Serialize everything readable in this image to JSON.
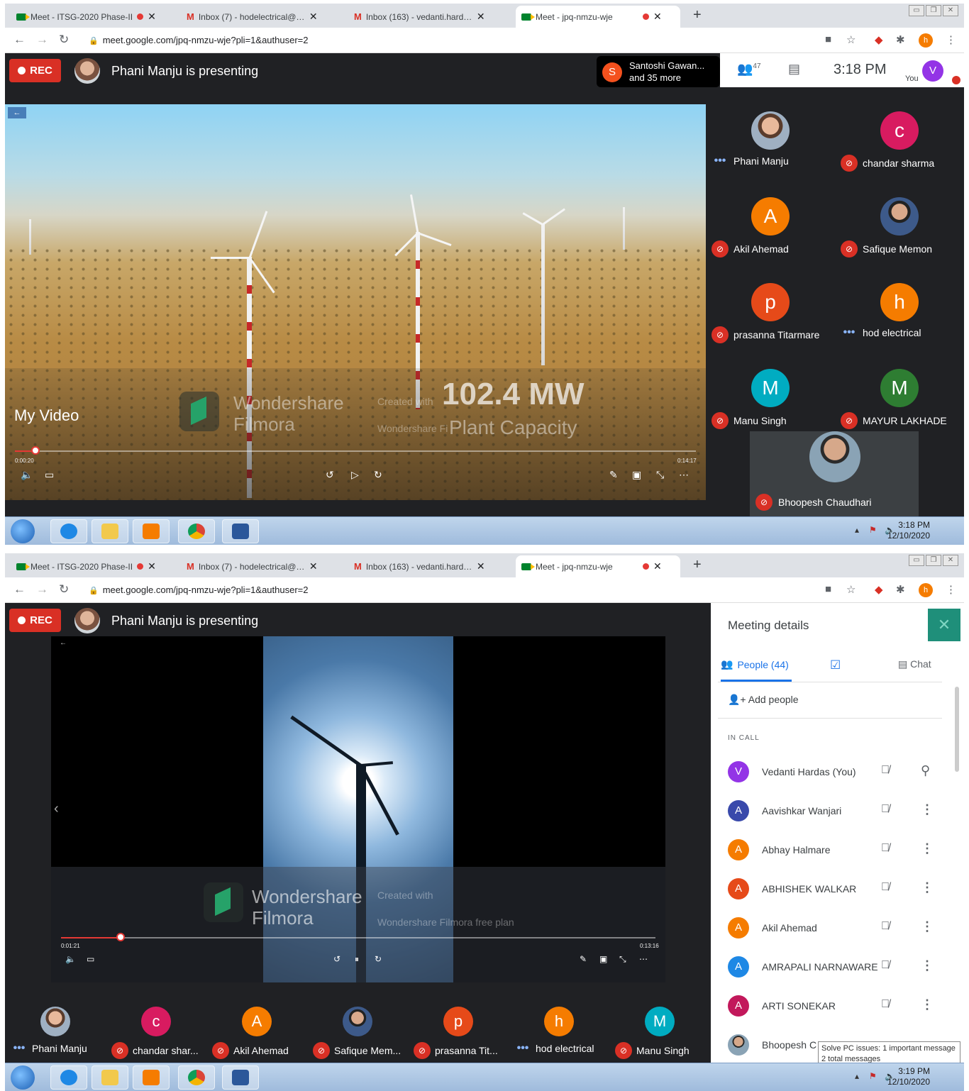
{
  "tabs": [
    {
      "title": "Meet - ITSG-2020 Phase-II",
      "icon": "meet-icon",
      "recording": true
    },
    {
      "title": "Inbox (7) - hodelectrical@kdkce.",
      "icon": "gmail-icon"
    },
    {
      "title": "Inbox (163) - vedanti.hardas@kd",
      "icon": "gmail-icon"
    },
    {
      "title": "Meet - jpq-nmzu-wje",
      "icon": "meet-icon",
      "recording": true,
      "active": true
    }
  ],
  "url": "meet.google.com/jpq-nmzu-wje?pli=1&authuser=2",
  "profile_initial": "h",
  "rec_label": "REC",
  "presenting_text": "Phani Manju is presenting",
  "shot1": {
    "joined": {
      "initial": "S",
      "line1": "Santoshi Gawan...",
      "line2": "and 35 more"
    },
    "people_count": "47",
    "clock": "3:18 PM",
    "you_label": "You",
    "you_initial": "V",
    "video": {
      "title": "My Video",
      "watermark1": "Wondershare",
      "watermark2": "Filmora",
      "created_with": "Created with",
      "wm_plan": "Wondershare Filmora free plan",
      "overlay_big": "102.4 MW",
      "overlay_sub": "Plant Capacity",
      "time_elapsed": "0:00:20",
      "time_total": "0:14:17",
      "progress": 0.03
    },
    "tiles": [
      {
        "name": "Phani Manju",
        "status": "speaking",
        "initial": "",
        "color": "#000000",
        "photo": true
      },
      {
        "name": "chandar sharma",
        "status": "muted",
        "initial": "c",
        "color": "#d81b60"
      },
      {
        "name": "Akil Ahemad",
        "status": "muted",
        "initial": "A",
        "color": "#f57c00"
      },
      {
        "name": "Safique Memon",
        "status": "muted",
        "initial": "",
        "color": "#000000",
        "photo": true
      },
      {
        "name": "prasanna Titarmare",
        "status": "muted",
        "initial": "p",
        "color": "#e64a19"
      },
      {
        "name": "hod electrical",
        "status": "speaking",
        "initial": "h",
        "color": "#f57c00"
      },
      {
        "name": "Manu Singh",
        "status": "muted",
        "initial": "M",
        "color": "#00acc1"
      },
      {
        "name": "MAYUR LAKHADE",
        "status": "muted",
        "initial": "M",
        "color": "#2e7d32"
      }
    ],
    "featured": {
      "name": "Bhoopesh Chaudhari",
      "status": "muted"
    },
    "tray_time": "3:18 PM",
    "tray_date": "12/10/2020"
  },
  "shot2": {
    "video": {
      "watermark1": "Wondershare",
      "watermark2": "Filmora",
      "created_with": "Created with",
      "wm_plan": "Wondershare Filmora free plan",
      "time_elapsed": "0:01:21",
      "time_total": "0:13:16",
      "progress": 0.1
    },
    "bottom_tiles": [
      {
        "name": "Phani Manju",
        "status": "speaking",
        "initial": "",
        "color": "#000000",
        "photo": true
      },
      {
        "name": "chandar shar...",
        "status": "muted",
        "initial": "c",
        "color": "#d81b60"
      },
      {
        "name": "Akil Ahemad",
        "status": "muted",
        "initial": "A",
        "color": "#f57c00"
      },
      {
        "name": "Safique Mem...",
        "status": "muted",
        "initial": "",
        "color": "#000000",
        "photo": true
      },
      {
        "name": "prasanna Tit...",
        "status": "muted",
        "initial": "p",
        "color": "#e64a19"
      },
      {
        "name": "hod electrical",
        "status": "speaking",
        "initial": "h",
        "color": "#f57c00"
      },
      {
        "name": "Manu Singh",
        "status": "muted",
        "initial": "M",
        "color": "#00acc1"
      }
    ],
    "sidebar": {
      "title": "Meeting details",
      "people_tab": "People (44)",
      "chat_tab": "Chat",
      "add_people": "Add people",
      "in_call": "IN CALL",
      "people": [
        {
          "name": "Vedanti Hardas (You)",
          "initial": "V",
          "color": "#9334e6",
          "action": "pin"
        },
        {
          "name": "Aavishkar Wanjari",
          "initial": "A",
          "color": "#3949ab",
          "action": "more"
        },
        {
          "name": "Abhay Halmare",
          "initial": "A",
          "color": "#f57c00",
          "action": "more"
        },
        {
          "name": "ABHISHEK WALKAR",
          "initial": "A",
          "color": "#e64a19",
          "action": "more"
        },
        {
          "name": "Akil Ahemad",
          "initial": "A",
          "color": "#f57c00",
          "action": "more"
        },
        {
          "name": "AMRAPALI NARNAWARE",
          "initial": "A",
          "color": "#1e88e5",
          "action": "more"
        },
        {
          "name": "ARTI SONEKAR",
          "initial": "A",
          "color": "#c2185b",
          "action": "more"
        },
        {
          "name": "Bhoopesh C",
          "initial": "",
          "color": "#777777",
          "action": "more",
          "photo": true
        }
      ]
    },
    "tooltip": {
      "line1": "Solve PC issues: 1 important message",
      "line2": "2 total messages"
    },
    "tray_time": "3:19 PM",
    "tray_date": "12/10/2020"
  }
}
